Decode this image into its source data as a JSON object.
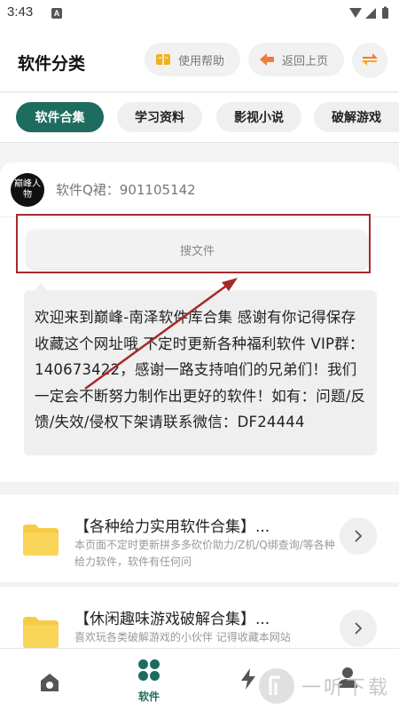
{
  "status_bar": {
    "time": "3:43",
    "notification_badge": "A",
    "icons": [
      "gear-icon",
      "wifi-icon",
      "signal-icon",
      "battery-icon"
    ]
  },
  "header": {
    "title": "软件分类",
    "help_label": "使用帮助",
    "back_label": "返回上页"
  },
  "tabs": [
    {
      "label": "软件合集",
      "active": true
    },
    {
      "label": "学习资料",
      "active": false
    },
    {
      "label": "影视小说",
      "active": false
    },
    {
      "label": "破解游戏",
      "active": false
    }
  ],
  "card": {
    "avatar_text": "巅峰人物",
    "group_text": "软件Q裙：901105142",
    "search_label": "搜文件",
    "message": "欢迎来到巅峰-南泽软件库合集 感谢有你记得保存收藏这个网址哦 不定时更新各种福利软件 VIP群：140673422，感谢一路支持咱们的兄弟们！我们一定会不断努力制作出更好的软件！如有：问题/反馈/失效/侵权下架请联系微信：DF24444"
  },
  "list": [
    {
      "title": "【各种给力实用软件合集】...",
      "desc": "本页面不定时更新拼多多砍价助力/Z机/Q绑查询/等各种给力软件，软件有任何问"
    },
    {
      "title": "【休闲趣味游戏破解合集】...",
      "desc": "喜欢玩各类破解游戏的小伙伴 记得收藏本网站"
    }
  ],
  "bottom_nav": [
    {
      "label": "",
      "icon": "home-icon"
    },
    {
      "label": "软件",
      "icon": "grid-icon"
    },
    {
      "label": "",
      "icon": "flash-icon"
    },
    {
      "label": "",
      "icon": "user-icon"
    }
  ],
  "watermark": {
    "text": "一听下载"
  },
  "colors": {
    "accent": "#1e6b5f",
    "annotation": "#a52a2a",
    "folder": "#f7cb45"
  }
}
